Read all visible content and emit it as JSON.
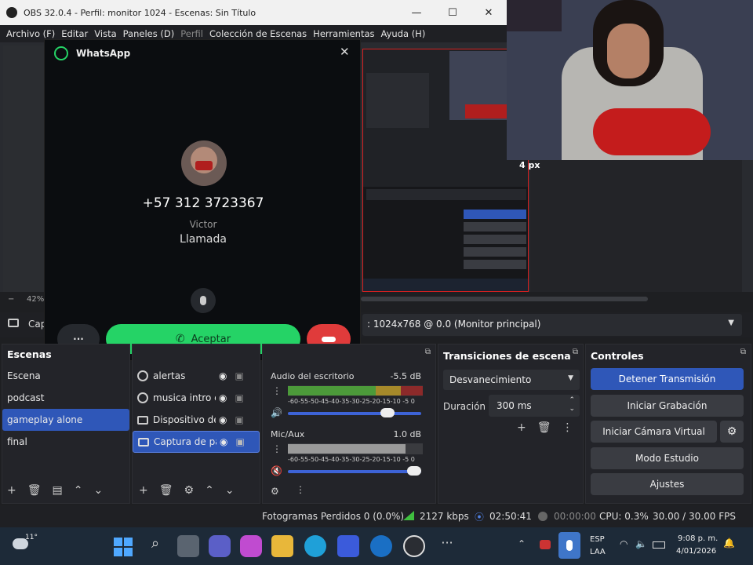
{
  "window": {
    "title": "OBS 32.0.4 - Perfil: monitor 1024 - Escenas: Sin Título"
  },
  "menu": [
    "Archivo (F)",
    "Editar",
    "Vista",
    "Paneles (D)",
    "Perfil",
    "Colección de Escenas",
    "Herramientas",
    "Ayuda (H)"
  ],
  "preview": {
    "zoom": "42%",
    "overlay_size": "4 px",
    "source_label": "Cap",
    "monitor_select": ": 1024x768 @ 0.0 (Monitor principal)"
  },
  "whatsapp": {
    "app_name": "WhatsApp",
    "phone": "+57 312 3723367",
    "contact": "Victor",
    "status": "Llamada",
    "more": "···",
    "accept": "Aceptar"
  },
  "scenes": {
    "title": "Escenas",
    "items": [
      "Escena",
      "podcast",
      "gameplay alone",
      "final"
    ],
    "selected": 2
  },
  "sources": {
    "items": [
      "alertas",
      "musica intro c",
      "Dispositivo de",
      "Captura de pa"
    ]
  },
  "audio": {
    "desktop": {
      "label": "Audio del escritorio",
      "db": "-5.5 dB"
    },
    "mic": {
      "label": "Mic/Aux",
      "db": "1.0 dB"
    },
    "scale": "-60-55-50-45-40-35-30-25-20-15-10 -5 0"
  },
  "transitions": {
    "title": "Transiciones de escena",
    "type": "Desvanecimiento",
    "duration_label": "Duración",
    "duration": "300 ms"
  },
  "controls": {
    "title": "Controles",
    "buttons": [
      "Detener Transmisión",
      "Iniciar Grabación",
      "Iniciar Cámara Virtual",
      "Modo Estudio",
      "Ajustes"
    ]
  },
  "status": {
    "dropped": "Fotogramas Perdidos 0 (0.0%)",
    "bitrate": "2127 kbps",
    "stream_time": "02:50:41",
    "rec_time": "00:00:00",
    "cpu": "CPU: 0.3%",
    "fps": "30.00 / 30.00 FPS"
  },
  "taskbar": {
    "weather": "11°",
    "lang": "ESP",
    "layout": "LAA",
    "time": "9:08 p. m.",
    "date": "4/01/2026"
  },
  "colors": {
    "accent": "#2f57b8",
    "accept_green": "#25d366",
    "hangup_red": "#e03b3b"
  }
}
